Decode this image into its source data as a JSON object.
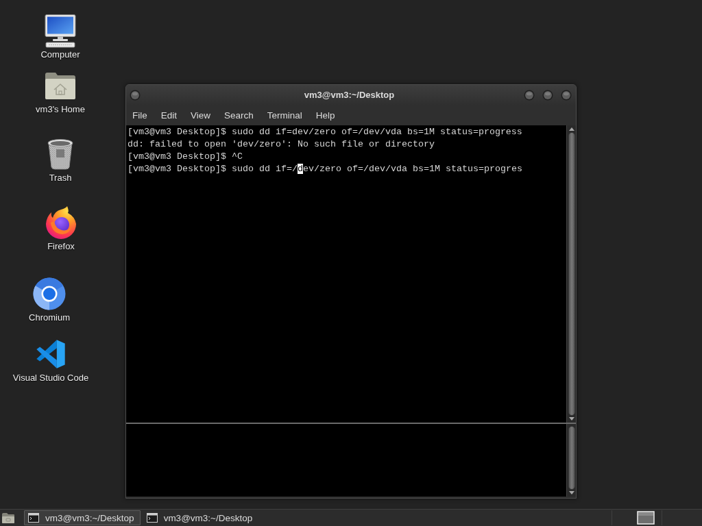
{
  "desktop_icons": [
    {
      "kind": "computer",
      "label": "Computer"
    },
    {
      "kind": "home",
      "label": "vm3's Home"
    },
    {
      "kind": "trash",
      "label": "Trash"
    },
    {
      "kind": "firefox",
      "label": "Firefox"
    },
    {
      "kind": "chromium",
      "label": "Chromium"
    },
    {
      "kind": "vscode",
      "label": "Visual Studio Code"
    }
  ],
  "window": {
    "title": "vm3@vm3:~/Desktop",
    "menu": [
      "File",
      "Edit",
      "View",
      "Search",
      "Terminal",
      "Help"
    ],
    "terminal_lines": [
      {
        "text": "[vm3@vm3 Desktop]$ sudo dd if=dev/zero of=/dev/vda bs=1M status=progress"
      },
      {
        "text": "dd: failed to open 'dev/zero': No such file or directory"
      },
      {
        "text": "[vm3@vm3 Desktop]$ ^C"
      },
      {
        "text": "[vm3@vm3 Desktop]$ sudo dd if=/",
        "cursor": "d",
        "text_after_cursor": "ev/zero of=/dev/vda bs=1M status=progres"
      }
    ]
  },
  "taskbar": {
    "tasks": [
      {
        "label": "vm3@vm3:~/Desktop",
        "selected": true
      },
      {
        "label": "vm3@vm3:~/Desktop",
        "selected": false
      }
    ]
  }
}
